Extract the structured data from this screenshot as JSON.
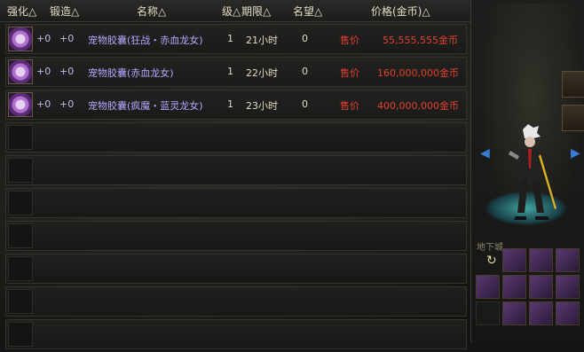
{
  "header": {
    "col_enhance": "强化△",
    "col_forge": "锻造△",
    "col_name": "名称△",
    "col_level": "级△",
    "col_duration": "期限△",
    "col_fame": "名望△",
    "col_price": "价格(金币)△"
  },
  "listings": [
    {
      "icon": "pet-capsule-icon",
      "enhance": "+0",
      "forge": "+0",
      "name": "宠物胶囊(狂战・赤血龙女)",
      "level": "1",
      "duration": "21小时",
      "fame": "0",
      "sell_label": "售价",
      "price": "55,555,555金币"
    },
    {
      "icon": "pet-capsule-icon",
      "enhance": "+0",
      "forge": "+0",
      "name": "宠物胶囊(赤血龙女)",
      "level": "1",
      "duration": "22小时",
      "fame": "0",
      "sell_label": "售价",
      "price": "160,000,000金币"
    },
    {
      "icon": "pet-capsule-icon",
      "enhance": "+0",
      "forge": "+0",
      "name": "宠物胶囊(疯魔・蓝灵龙女)",
      "level": "1",
      "duration": "23小时",
      "fame": "0",
      "sell_label": "售价",
      "price": "400,000,000金币"
    }
  ],
  "empty_rows": 7,
  "right_panel": {
    "inventory_label": "地下城",
    "nav_left_icon": "arrow-left-icon",
    "nav_right_icon": "arrow-right-icon"
  },
  "colors": {
    "name": "#b4a8ff",
    "price": "#e04030",
    "plus": "#c0b8e8"
  }
}
